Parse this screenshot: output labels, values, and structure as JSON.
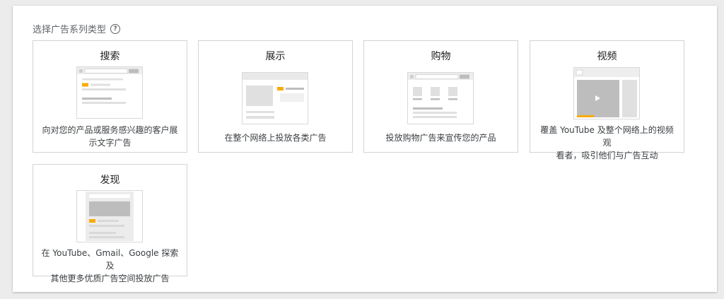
{
  "header": {
    "title": "选择广告系列类型",
    "help_icon": "question-circle-icon"
  },
  "cards": [
    {
      "id": "search",
      "title": "搜索",
      "desc_lines": [
        "向对您的产品或服务感兴趣的客户展",
        "示文字广告"
      ]
    },
    {
      "id": "display",
      "title": "展示",
      "desc_lines": [
        "在整个网络上投放各类广告"
      ]
    },
    {
      "id": "shopping",
      "title": "购物",
      "desc_lines": [
        "投放购物广告来宣传您的产品"
      ]
    },
    {
      "id": "video",
      "title": "视频",
      "desc_lines": [
        "覆盖 YouTube 及整个网络上的视频观",
        "看者，吸引他们与广告互动"
      ]
    },
    {
      "id": "discovery",
      "title": "发现",
      "desc_lines": [
        "在 YouTube、Gmail、Google 探索及",
        "其他更多优质广告空间投放广告"
      ]
    }
  ],
  "colors": {
    "accent": "#f9ab00",
    "gray_light": "#e0e0e0",
    "gray_mid": "#bdbdbd",
    "border": "#d3d3d3"
  }
}
